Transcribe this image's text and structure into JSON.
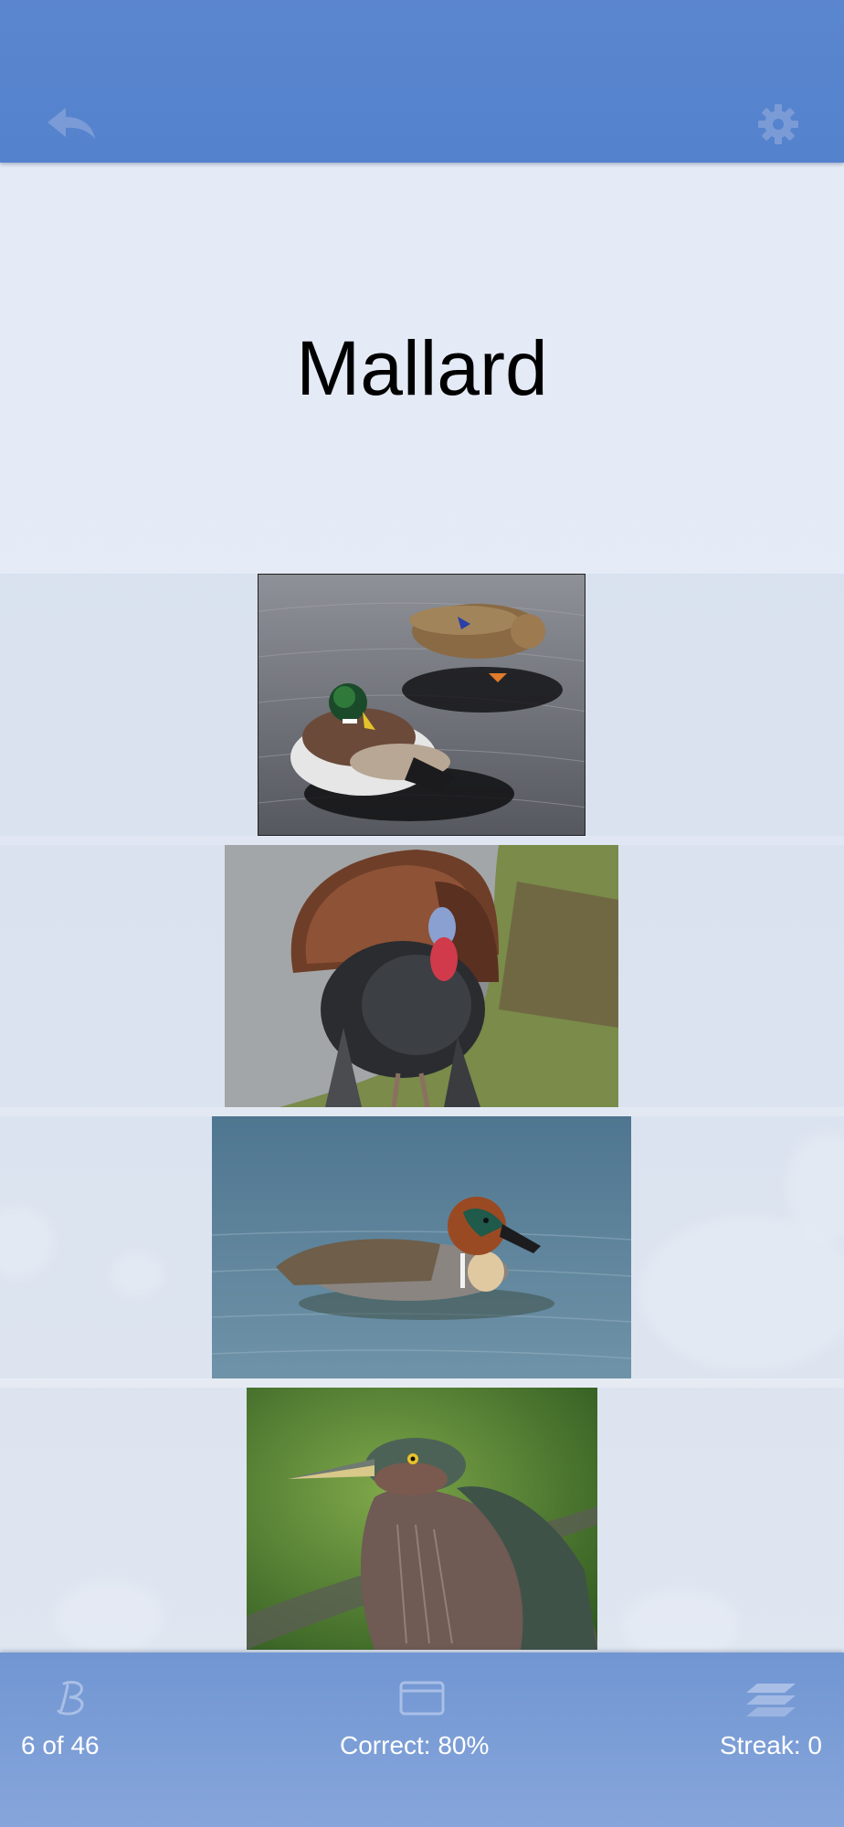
{
  "header": {
    "back_icon": "back-arrow-icon",
    "settings_icon": "gear-icon",
    "accent_color": "#5583cd"
  },
  "question": {
    "title": "Mallard"
  },
  "choices": [
    {
      "subject": "mallard pair on water"
    },
    {
      "subject": "wild turkey displaying"
    },
    {
      "subject": "green-winged teal on water"
    },
    {
      "subject": "green heron"
    }
  ],
  "footer": {
    "progress_text": "6 of 46",
    "correct_text": "Correct: 80%",
    "streak_text": "Streak: 0",
    "left_icon": "script-b-icon",
    "center_icon": "card-icon",
    "right_icon": "stack-icon"
  }
}
